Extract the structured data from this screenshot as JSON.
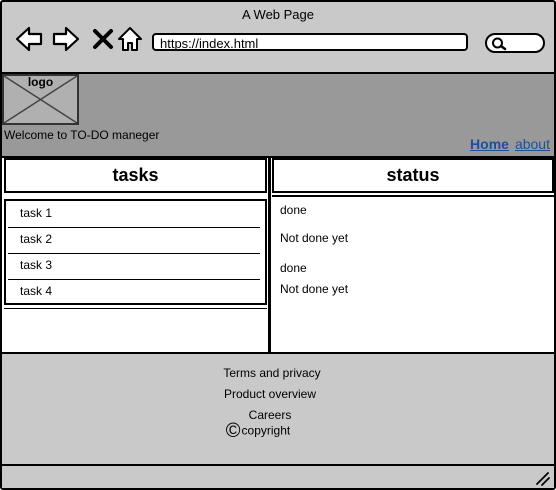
{
  "window": {
    "title": "A Web Page",
    "url": "https://index.html",
    "search_placeholder": ""
  },
  "nav_icons": [
    "back-arrow-icon",
    "forward-arrow-icon",
    "close-icon",
    "home-icon",
    "search-icon"
  ],
  "header": {
    "logo_label": "logo",
    "welcome_text": "Welcome to TO-DO maneger",
    "links": {
      "home": "Home",
      "about": "about"
    }
  },
  "columns": {
    "tasks": "tasks",
    "status": "status"
  },
  "tasks": [
    "task 1",
    "task 2",
    "task 3",
    "task 4"
  ],
  "statuses": [
    "done",
    "Not done yet",
    "done",
    "Not done yet"
  ],
  "footer": {
    "terms": "Terms and privacy",
    "product": "Product overview",
    "careers": "Careers",
    "copyright": "copyright"
  },
  "colors": {
    "chrome": "#c9c9c9",
    "header": "#999999",
    "link": "#1d4f9c"
  }
}
